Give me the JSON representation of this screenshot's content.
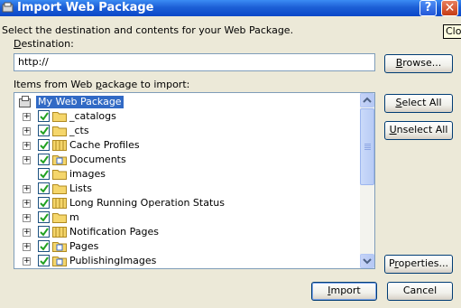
{
  "window": {
    "title": "Import Web Package",
    "help_label": "?",
    "close_label": "✕",
    "tooltip": "Close"
  },
  "instructions": "Select the destination and contents for your Web Package.",
  "destination": {
    "label_pre": "",
    "label_accel": "D",
    "label_post": "estination:",
    "value": "http://"
  },
  "browse_button": {
    "pre": "",
    "accel": "B",
    "post": "rowse..."
  },
  "items_label": {
    "pre": "Items from Web ",
    "accel": "p",
    "post": "ackage to import:"
  },
  "tree": {
    "root": "My Web Package",
    "items": [
      {
        "label": "_catalogs",
        "icon": "folder-icon",
        "expandable": true,
        "checked": true
      },
      {
        "label": "_cts",
        "icon": "folder-icon",
        "expandable": true,
        "checked": true
      },
      {
        "label": "Cache Profiles",
        "icon": "list-icon",
        "expandable": true,
        "checked": true
      },
      {
        "label": "Documents",
        "icon": "doc-library-icon",
        "expandable": true,
        "checked": true
      },
      {
        "label": "images",
        "icon": "folder-icon",
        "expandable": false,
        "checked": true
      },
      {
        "label": "Lists",
        "icon": "folder-icon",
        "expandable": true,
        "checked": true
      },
      {
        "label": "Long Running Operation Status",
        "icon": "list-icon",
        "expandable": true,
        "checked": true
      },
      {
        "label": "m",
        "icon": "folder-icon",
        "expandable": true,
        "checked": true
      },
      {
        "label": "Notification Pages",
        "icon": "list-icon",
        "expandable": true,
        "checked": true
      },
      {
        "label": "Pages",
        "icon": "doc-library-icon",
        "expandable": true,
        "checked": true
      },
      {
        "label": "PublishingImages",
        "icon": "doc-library-icon",
        "expandable": true,
        "checked": true
      },
      {
        "label": "",
        "icon": "folder-icon",
        "expandable": true,
        "checked": true
      }
    ]
  },
  "select_all": {
    "pre": "",
    "accel": "S",
    "post": "elect All"
  },
  "unselect_all": {
    "pre": "",
    "accel": "U",
    "post": "nselect All"
  },
  "properties": {
    "pre": "P",
    "accel": "r",
    "post": "operties..."
  },
  "import_button": {
    "pre": "",
    "accel": "I",
    "post": "mport"
  },
  "cancel_label": "Cancel",
  "colors": {
    "titlebar": "#0a47c8",
    "dialog_bg": "#ece9d8",
    "selection": "#316ac5",
    "checkmark": "#21a121",
    "folder": "#f5d66b"
  }
}
